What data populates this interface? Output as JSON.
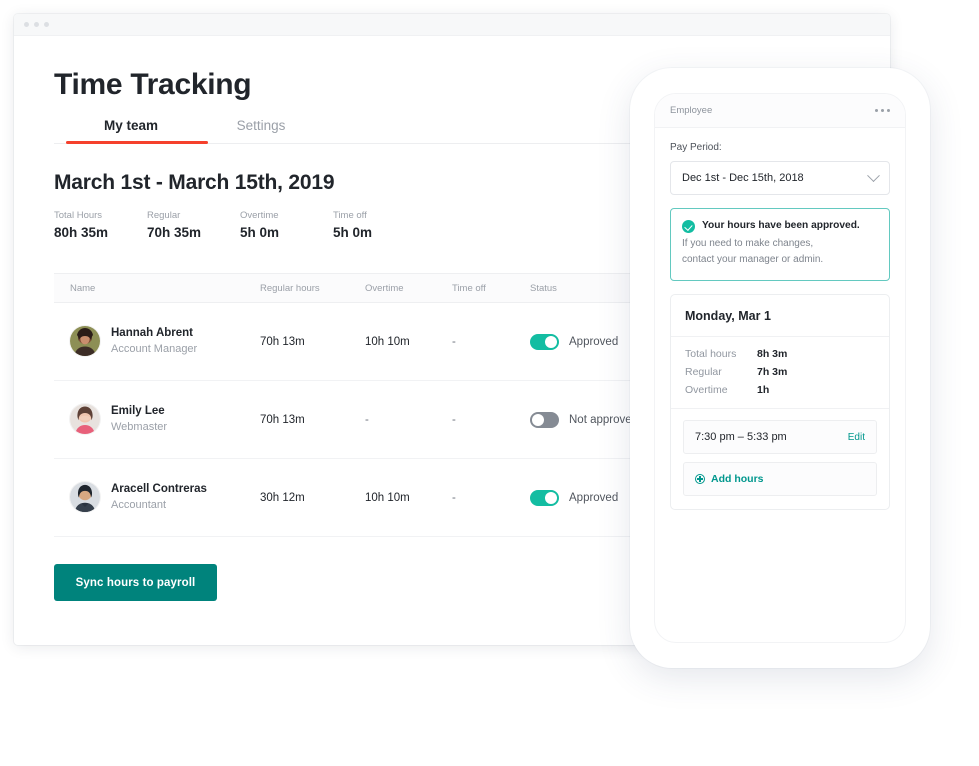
{
  "window": {
    "dots": 3
  },
  "app": {
    "title": "Time Tracking",
    "tabs": [
      {
        "label": "My team",
        "active": true
      },
      {
        "label": "Settings",
        "active": false
      }
    ],
    "period_title": "March 1st - March 15th, 2019",
    "stats": [
      {
        "label": "Total Hours",
        "value": "80h 35m"
      },
      {
        "label": "Regular",
        "value": "70h 35m"
      },
      {
        "label": "Overtime",
        "value": "5h 0m"
      },
      {
        "label": "Time off",
        "value": "5h 0m"
      }
    ],
    "table": {
      "headers": [
        "Name",
        "Regular hours",
        "Overtime",
        "Time off",
        "Status"
      ],
      "rows": [
        {
          "name": "Hannah Abrent",
          "role": "Account Manager",
          "regular_hours": "70h 13m",
          "overtime": "10h 10m",
          "time_off": "-",
          "status": "Approved",
          "approved": true
        },
        {
          "name": "Emily Lee",
          "role": "Webmaster",
          "regular_hours": "70h 13m",
          "overtime": "-",
          "time_off": "-",
          "status": "Not approved",
          "approved": false
        },
        {
          "name": "Aracell Contreras",
          "role": "Accountant",
          "regular_hours": "30h 12m",
          "overtime": "10h 10m",
          "time_off": "-",
          "status": "Approved",
          "approved": true
        }
      ]
    },
    "sync_button": "Sync hours to payroll"
  },
  "phone": {
    "header_title": "Employee",
    "menu_icon": "kebab-menu-icon",
    "pay_period_label": "Pay Period:",
    "pay_period_value": "Dec 1st - Dec 15th, 2018",
    "alert": {
      "title": "Your hours have been approved.",
      "line1": "If you need to make changes,",
      "line2": "contact your manager or admin."
    },
    "day": {
      "title": "Monday, Mar 1",
      "stats": [
        {
          "label": "Total hours",
          "value": "8h 3m"
        },
        {
          "label": "Regular",
          "value": "7h 3m"
        },
        {
          "label": "Overtime",
          "value": "1h"
        }
      ],
      "entry": {
        "time": "7:30 pm –  5:33 pm",
        "edit_label": "Edit"
      },
      "add_hours_label": "Add hours"
    }
  },
  "colors": {
    "accent_red": "#F5402C",
    "teal": "#13BDA2",
    "teal_dark": "#00837C",
    "text": "#21252B",
    "muted": "#9BA0A8"
  }
}
